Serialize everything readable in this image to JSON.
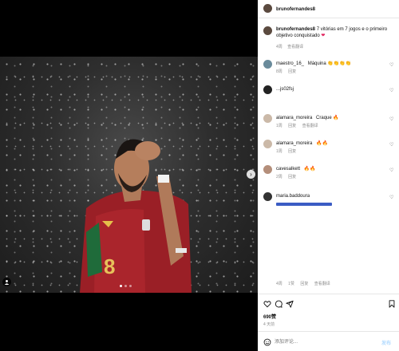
{
  "post": {
    "author": "brunofernandes8",
    "caption": "7 vitórias em 7 jogos e o primeiro objetivo conquistado",
    "caption_emoji": "❤",
    "caption_time": "4周",
    "caption_action": "查看翻译"
  },
  "comments": [
    {
      "user": "maestro_16_",
      "text": "Máquina 👏👏👏👏",
      "time": "8周",
      "reply": "回复"
    },
    {
      "user": "...js02fsj",
      "text": "",
      "time": "",
      "reply": ""
    },
    {
      "user": "alamara_moreira",
      "text": "Craque 🔥",
      "time": "1周",
      "reply": "回复",
      "translate": "查看翻译"
    },
    {
      "user": "alamara_moreira",
      "text": "🔥🔥",
      "time": "1周",
      "reply": "回复"
    },
    {
      "user": "cavesalkett",
      "text": "🔥🔥",
      "time": "2周",
      "reply": "回复"
    },
    {
      "user": "maria.baddoura",
      "text": "",
      "time": "",
      "reply": ""
    }
  ],
  "comment_meta": {
    "time": "4周",
    "likes": "1赞",
    "reply": "回复",
    "translate": "查看翻译"
  },
  "actions": {
    "likes": "690赞",
    "date": "4 天前"
  },
  "composer": {
    "placeholder": "添加评论...",
    "post_label": "发布"
  },
  "colors": {
    "heart": "#e0245e",
    "link": "#0095f6",
    "bar": "#3b5cc4"
  },
  "icons": [
    "heart-icon",
    "comment-icon",
    "share-icon",
    "bookmark-icon",
    "emoji-icon",
    "tag-icon",
    "next-arrow-icon"
  ]
}
